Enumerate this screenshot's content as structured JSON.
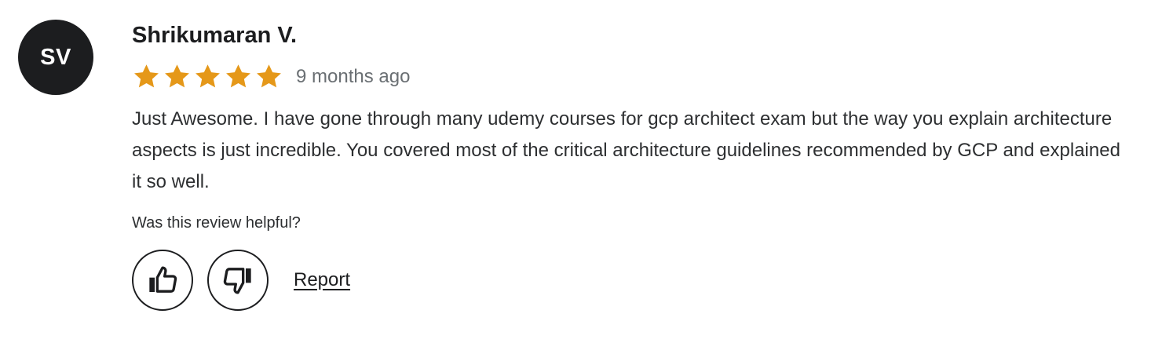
{
  "reviewer": {
    "initials": "SV",
    "name": "Shrikumaran V."
  },
  "rating": {
    "stars": 5,
    "max": 5,
    "date_label": "9 months ago",
    "color": "#e59819"
  },
  "review": {
    "text": "Just Awesome. I have gone through many udemy courses for gcp architect exam but the way you explain architecture aspects is just incredible. You covered most of the critical architecture guidelines recommended by GCP and explained it so well."
  },
  "feedback": {
    "question": "Was this review helpful?",
    "helpful_icon": "thumbs-up-icon",
    "unhelpful_icon": "thumbs-down-icon",
    "report_label": "Report"
  }
}
